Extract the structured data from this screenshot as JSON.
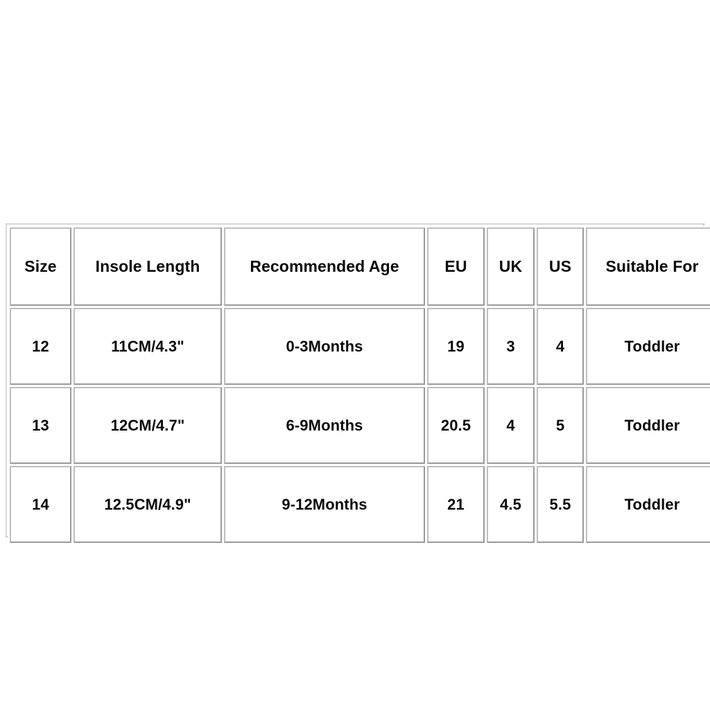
{
  "page": {
    "background_color": "#ffffff",
    "text_color": "#0a0a0a",
    "border_color": "#a8a8a8"
  },
  "table": {
    "name": "shoe-size-chart",
    "columns": [
      {
        "key": "size",
        "label": "Size"
      },
      {
        "key": "insole",
        "label": "Insole Length"
      },
      {
        "key": "age",
        "label": "Recommended Age"
      },
      {
        "key": "eu",
        "label": "EU"
      },
      {
        "key": "uk",
        "label": "UK"
      },
      {
        "key": "us",
        "label": "US"
      },
      {
        "key": "suitable",
        "label": "Suitable For"
      }
    ],
    "rows": [
      {
        "size": "12",
        "insole": "11CM/4.3\"",
        "age": "0-3Months",
        "eu": "19",
        "uk": "3",
        "us": "4",
        "suitable": "Toddler"
      },
      {
        "size": "13",
        "insole": "12CM/4.7\"",
        "age": "6-9Months",
        "eu": "20.5",
        "uk": "4",
        "us": "5",
        "suitable": "Toddler"
      },
      {
        "size": "14",
        "insole": "12.5CM/4.9\"",
        "age": "9-12Months",
        "eu": "21",
        "uk": "4.5",
        "us": "5.5",
        "suitable": "Toddler"
      }
    ]
  }
}
